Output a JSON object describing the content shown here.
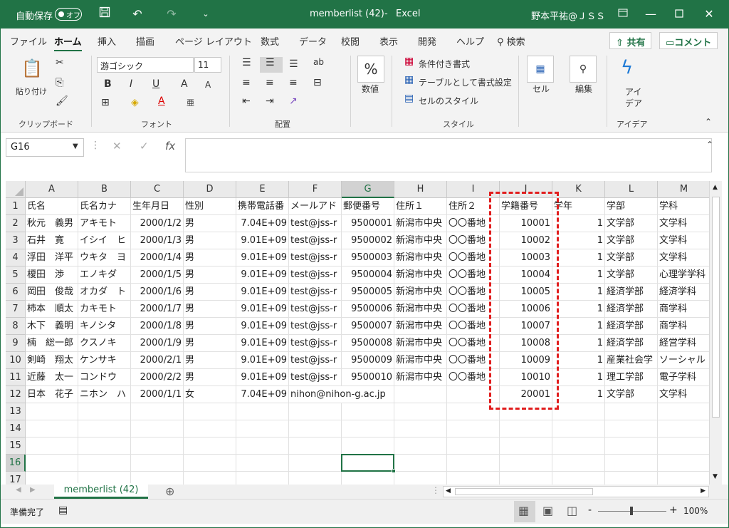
{
  "titlebar": {
    "autosave_label": "自動保存",
    "autosave_state": "オフ",
    "save_icon": "save-icon",
    "undo_icon": "undo-icon",
    "redo_icon": "redo-icon",
    "qat_more": "⌄",
    "filename": "memberlist (42)",
    "separator": "-",
    "app_name": "Excel",
    "user": "野本平祐@ＪＳＳ",
    "accent": "#217346"
  },
  "menu": {
    "tabs": [
      "ファイル",
      "ホーム",
      "挿入",
      "描画",
      "ページ レイアウト",
      "数式",
      "データ",
      "校閲",
      "表示",
      "開発",
      "ヘルプ"
    ],
    "active": "ホーム",
    "search": "検索",
    "share": "共有",
    "comment": "コメント"
  },
  "ribbon": {
    "clipboard": {
      "paste": "貼り付け",
      "label": "クリップボード"
    },
    "font": {
      "name": "游ゴシック",
      "size": "11",
      "bold": "B",
      "italic": "I",
      "underline": "U",
      "grow": "A",
      "shrink": "A",
      "label": "フォント"
    },
    "align": {
      "label": "配置"
    },
    "number": {
      "percent": "%",
      "label": "数値"
    },
    "styles": {
      "conditional": "条件付き書式",
      "table": "テーブルとして書式設定",
      "cell_style": "セルのスタイル",
      "label": "スタイル"
    },
    "cells": {
      "label": "セル"
    },
    "edit": {
      "label": "編集"
    },
    "ideas": {
      "button_line1": "アイ",
      "button_line2": "デア",
      "label": "アイデア"
    }
  },
  "formula": {
    "namebox": "G16",
    "cancel": "✕",
    "enter": "✓",
    "fx": "fx",
    "content": ""
  },
  "grid": {
    "columns": [
      "A",
      "B",
      "C",
      "D",
      "E",
      "F",
      "G",
      "H",
      "I",
      "J",
      "K",
      "L",
      "M"
    ],
    "selected_column": "G",
    "selected_row": "16",
    "rows": [
      [
        "1",
        "氏名",
        "氏名カナ",
        "生年月日",
        "性別",
        "携帯電話番",
        "メールアド",
        "郵便番号",
        "住所１",
        "住所２",
        "学籍番号",
        "学年",
        "学部",
        "学科"
      ],
      [
        "2",
        "秋元　義男",
        "アキモト　",
        "2000/1/2",
        "男",
        "7.04E+09",
        "test@jss-r",
        "9500001",
        "新潟市中央",
        "〇〇番地",
        "10001",
        "1",
        "文学部",
        "文学科"
      ],
      [
        "3",
        "石井　寛",
        "イシイ　ヒ",
        "2000/1/3",
        "男",
        "9.01E+09",
        "test@jss-r",
        "9500002",
        "新潟市中央",
        "〇〇番地",
        "10002",
        "1",
        "文学部",
        "文学科"
      ],
      [
        "4",
        "浮田　洋平",
        "ウキタ　ヨ",
        "2000/1/4",
        "男",
        "9.01E+09",
        "test@jss-r",
        "9500003",
        "新潟市中央",
        "〇〇番地",
        "10003",
        "1",
        "文学部",
        "文学科"
      ],
      [
        "5",
        "榎田　渉",
        "エノキダ　",
        "2000/1/5",
        "男",
        "9.01E+09",
        "test@jss-r",
        "9500004",
        "新潟市中央",
        "〇〇番地",
        "10004",
        "1",
        "文学部",
        "心理学学科"
      ],
      [
        "6",
        "岡田　俊哉",
        "オカダ　ト",
        "2000/1/6",
        "男",
        "9.01E+09",
        "test@jss-r",
        "9500005",
        "新潟市中央",
        "〇〇番地",
        "10005",
        "1",
        "経済学部",
        "経済学科"
      ],
      [
        "7",
        "柿本　順太",
        "カキモト　",
        "2000/1/7",
        "男",
        "9.01E+09",
        "test@jss-r",
        "9500006",
        "新潟市中央",
        "〇〇番地",
        "10006",
        "1",
        "経済学部",
        "商学科"
      ],
      [
        "8",
        "木下　義明",
        "キノシタ　",
        "2000/1/8",
        "男",
        "9.01E+09",
        "test@jss-r",
        "9500007",
        "新潟市中央",
        "〇〇番地",
        "10007",
        "1",
        "経済学部",
        "商学科"
      ],
      [
        "9",
        "楠　総一郎",
        "クスノキ　",
        "2000/1/9",
        "男",
        "9.01E+09",
        "test@jss-r",
        "9500008",
        "新潟市中央",
        "〇〇番地",
        "10008",
        "1",
        "経済学部",
        "経営学科"
      ],
      [
        "10",
        "剣崎　翔太",
        "ケンサキ　",
        "2000/2/1",
        "男",
        "9.01E+09",
        "test@jss-r",
        "9500009",
        "新潟市中央",
        "〇〇番地",
        "10009",
        "1",
        "産業社会学",
        "ソーシャル"
      ],
      [
        "11",
        "近藤　太一",
        "コンドウ　",
        "2000/2/2",
        "男",
        "9.01E+09",
        "test@jss-r",
        "9500010",
        "新潟市中央",
        "〇〇番地",
        "10010",
        "1",
        "理工学部",
        "電子学科"
      ],
      [
        "12",
        "日本　花子",
        "ニホン　ハ",
        "2000/1/1",
        "女",
        "7.04E+09",
        "nihon@nihon-g.ac.jp",
        "",
        "",
        "",
        "20001",
        "1",
        "文学部",
        "文学科"
      ],
      [
        "13",
        "",
        "",
        "",
        "",
        "",
        "",
        "",
        "",
        "",
        "",
        "",
        "",
        ""
      ],
      [
        "14",
        "",
        "",
        "",
        "",
        "",
        "",
        "",
        "",
        "",
        "",
        "",
        "",
        ""
      ],
      [
        "15",
        "",
        "",
        "",
        "",
        "",
        "",
        "",
        "",
        "",
        "",
        "",
        "",
        ""
      ],
      [
        "16",
        "",
        "",
        "",
        "",
        "",
        "",
        "",
        "",
        "",
        "",
        "",
        "",
        ""
      ],
      [
        "17",
        "",
        "",
        "",
        "",
        "",
        "",
        "",
        "",
        "",
        "",
        "",
        "",
        ""
      ]
    ],
    "highlight_color": "#e11d1d"
  },
  "sheets": {
    "tabs": [
      "memberlist (42)"
    ],
    "add": "⊕"
  },
  "status": {
    "ready": "準備完了",
    "zoom": "100%",
    "minus": "-",
    "plus": "+"
  }
}
